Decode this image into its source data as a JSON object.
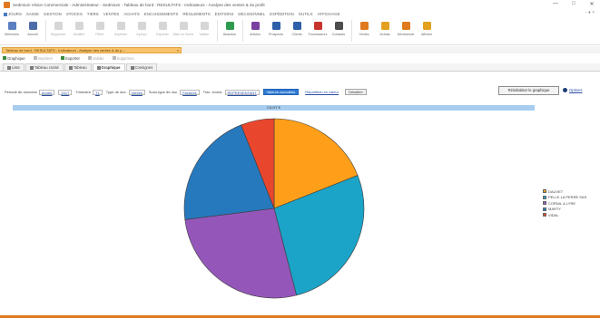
{
  "window": {
    "title": "Sedmium Vision Commerciale - Administrateur - Sedmium - Tableau de bord : RESULTATS - Indicateurs - Analyse des ventes & du profit",
    "controls": [
      "—",
      "□",
      "✕"
    ]
  },
  "menubar": {
    "items": [
      "JOURS",
      "SAISIE",
      "GESTION",
      "STOCKS",
      "TIERS",
      "VENTES",
      "ACHATS",
      "ENCAISSEMENTS",
      "RÈGLEMENTS",
      "EDITIONS",
      "DÉCISIONNEL",
      "EXPÉDITION",
      "OUTILS",
      "AFFICHAGE"
    ],
    "right": "- ♦ ×"
  },
  "toolbar": {
    "buttons": [
      {
        "label": "Mémoires",
        "color": "#5b7fc0",
        "faded": false
      },
      {
        "label": "Accueil",
        "color": "#4d6da8",
        "faded": false
      },
      {
        "label": "Supprimer",
        "color": "#8a8a8a",
        "faded": true
      },
      {
        "label": "Modifier",
        "color": "#8a8a8a",
        "faded": true
      },
      {
        "label": "Filtrer",
        "color": "#8a8a8a",
        "faded": true
      },
      {
        "label": "Imprimer",
        "color": "#8a8a8a",
        "faded": true
      },
      {
        "label": "Aperçu",
        "color": "#8a8a8a",
        "faded": true
      },
      {
        "label": "Exporter",
        "color": "#8a8a8a",
        "faded": true
      },
      {
        "label": "Mise en forme",
        "color": "#8a8a8a",
        "faded": true
      },
      {
        "label": "Valider",
        "color": "#8a8a8a",
        "faded": true
      },
      {
        "label": "Abandon",
        "color": "#2e9a4e",
        "faded": false
      },
      {
        "label": "Articles",
        "color": "#7a3fa0",
        "faded": false
      },
      {
        "label": "Prospects",
        "color": "#2f5fa8",
        "faded": false
      },
      {
        "label": "Clients",
        "color": "#2f5fa8",
        "faded": false
      },
      {
        "label": "Fournisseurs",
        "color": "#c8332b",
        "faded": false
      },
      {
        "label": "Contacts",
        "color": "#4d4d4d",
        "faded": false
      },
      {
        "label": "Ventes",
        "color": "#e07a1f",
        "faded": false
      },
      {
        "label": "Achats",
        "color": "#e3a01f",
        "faded": false
      },
      {
        "label": "Décisionnel",
        "color": "#e07a1f",
        "faded": false
      },
      {
        "label": "Afficher",
        "color": "#e3a01f",
        "faded": false
      }
    ]
  },
  "doc_tab": {
    "label": "Tableau de bord : RESULTATS - Indicateurs - Analyse des ventes & du p...",
    "close": "×"
  },
  "actions": {
    "items": [
      {
        "label": "Graphique",
        "disabled": false
      },
      {
        "label": "Imprimer",
        "disabled": true
      },
      {
        "label": "Exporter",
        "disabled": false
      },
      {
        "label": "Valider",
        "disabled": true
      },
      {
        "label": "Supprimer",
        "disabled": true
      }
    ]
  },
  "view_tabs": [
    "Liste",
    "Tableau croisé",
    "Tableau",
    "Graphique",
    "Consignes"
  ],
  "active_view_tab": 3,
  "params": {
    "period_label": "Période de données",
    "period_value": "Année",
    "year_value": "2017",
    "trimester_label": "Trimestre",
    "trimester_value": "T1",
    "type_label": "Type de doc.",
    "type_value": "Ventes",
    "subtype_label": "Sous-type de doc.",
    "subtype_value": "Factures",
    "axis_label": "Trac. évolut.",
    "axis_value": "REPRESENTANT",
    "buttons": [
      "Valeurs cumulées",
      "Répartition en valeur",
      "Détaillée"
    ],
    "selected_button": 0
  },
  "reinit_label": "Réinitialiser le graphique",
  "options_label": "Options",
  "chart_data": {
    "type": "pie",
    "title": "CA HT €",
    "categories": [
      "DAUVET",
      "PELLE LA PERRE SAS",
      "CORNIL & LYRE",
      "MARTY",
      "VIDAL"
    ],
    "values": [
      19,
      27,
      27,
      21,
      6
    ],
    "colors": [
      "#ff9f19",
      "#1ba4c8",
      "#9457b9",
      "#2779be",
      "#e8472e"
    ],
    "legend_placement": "right",
    "grid": false
  }
}
